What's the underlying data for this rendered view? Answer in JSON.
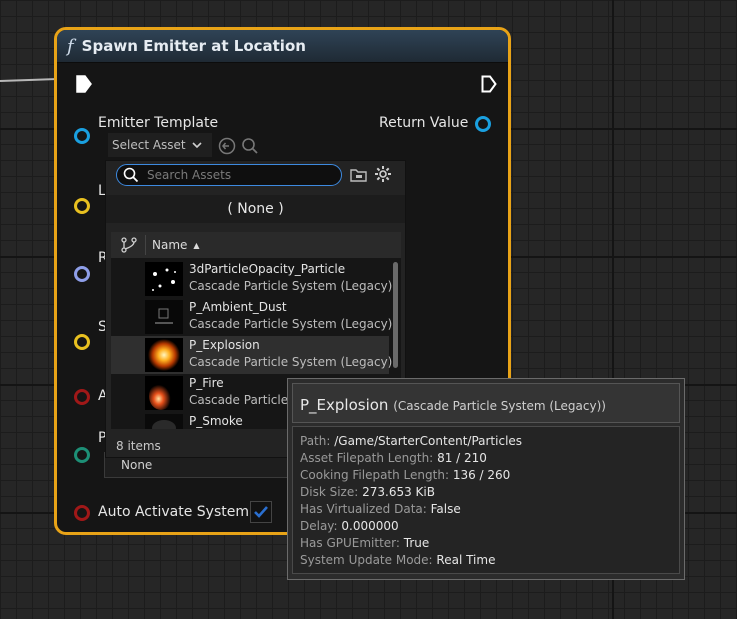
{
  "node": {
    "title": "Spawn Emitter at Location",
    "func_glyph": "f"
  },
  "pins": {
    "emitter_template": "Emitter Template",
    "return_value": "Return Value",
    "location_partial": "L",
    "rotation_partial": "R",
    "scale_partial": "S",
    "auto_destroy_partial": "A",
    "pooling_partial": "P",
    "pooling_value": "None",
    "auto_activate": "Auto Activate System"
  },
  "picker": {
    "select_label": "Select Asset",
    "search_placeholder": "Search Assets",
    "none_option": "( None )",
    "name_header": "Name",
    "items_count": "8 items",
    "items": [
      {
        "name": "3dParticleOpacity_Particle",
        "type": "Cascade Particle System (Legacy)"
      },
      {
        "name": "P_Ambient_Dust",
        "type": "Cascade Particle System (Legacy)"
      },
      {
        "name": "P_Explosion",
        "type": "Cascade Particle System (Legacy)"
      },
      {
        "name": "P_Fire",
        "type": "Cascade Particle"
      },
      {
        "name": "P_Smoke",
        "type": ""
      }
    ]
  },
  "tooltip": {
    "title": "P_Explosion",
    "subtitle": "(Cascade Particle System (Legacy))",
    "rows": [
      {
        "key": "Path:",
        "value": "/Game/StarterContent/Particles"
      },
      {
        "key": "Asset Filepath Length:",
        "value": "81 / 210"
      },
      {
        "key": "Cooking Filepath Length:",
        "value": "136 / 260"
      },
      {
        "key": "Disk Size:",
        "value": "273.653 KiB"
      },
      {
        "key": "Has Virtualized Data:",
        "value": "False"
      },
      {
        "key": "Delay:",
        "value": "0.000000"
      },
      {
        "key": "Has GPUEmitter:",
        "value": "True"
      },
      {
        "key": "System Update Mode:",
        "value": "Real Time"
      }
    ]
  },
  "colors": {
    "node_border": "#e8a317",
    "object_pin": "#1aa0e0",
    "struct_pin": "#e8c020",
    "rotator_pin": "#8e9ee8",
    "bool_pin": "#a01818",
    "teal_pin": "#1d8f76",
    "checkbox": "#2a6fd0"
  }
}
